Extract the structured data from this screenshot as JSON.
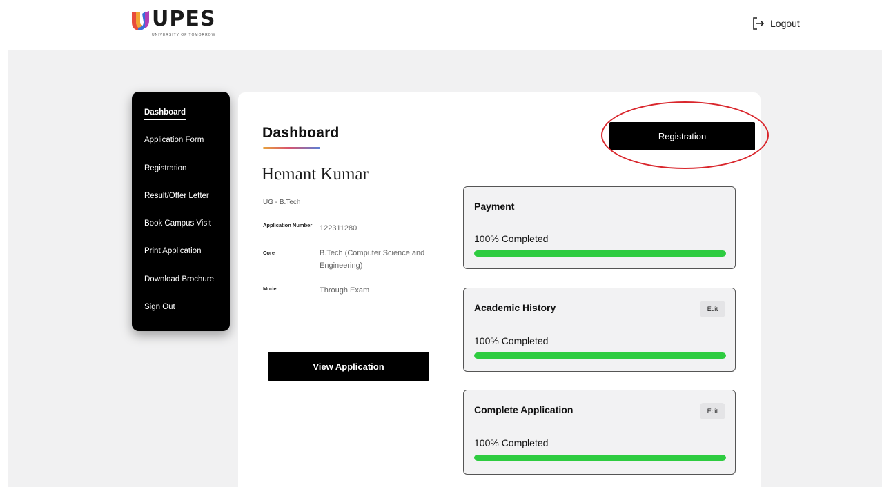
{
  "header": {
    "logo_text": "UPES",
    "logo_tagline": "UNIVERSITY OF TOMORROW",
    "logout_label": "Logout"
  },
  "sidebar": {
    "items": [
      {
        "label": "Dashboard",
        "active": true
      },
      {
        "label": "Application Form"
      },
      {
        "label": "Registration"
      },
      {
        "label": "Result/Offer Letter"
      },
      {
        "label": "Book Campus Visit"
      },
      {
        "label": "Print Application"
      },
      {
        "label": "Download Brochure"
      },
      {
        "label": "Sign Out"
      }
    ]
  },
  "main": {
    "title": "Dashboard",
    "registration_button": "Registration",
    "student": {
      "name": "Hemant Kumar",
      "program": "UG - B.Tech",
      "application_number_label": "Application Number",
      "application_number": "122311280",
      "core_label": "Core",
      "core": "B.Tech (Computer Science and Engineering)",
      "mode_label": "Mode",
      "mode": "Through Exam"
    },
    "view_application_button": "View Application",
    "status_cards": [
      {
        "title": "Payment",
        "status": "100% Completed",
        "progress": 1.0,
        "has_edit": false
      },
      {
        "title": "Academic History",
        "status": "100% Completed",
        "progress": 1.0,
        "has_edit": true,
        "edit_label": "Edit"
      },
      {
        "title": "Complete Application",
        "status": "100% Completed",
        "progress": 1.0,
        "has_edit": true,
        "edit_label": "Edit"
      }
    ]
  },
  "colors": {
    "accent_black": "#000000",
    "progress_green": "#2ecc40",
    "highlight_red": "#d9262c",
    "background_gray": "#f1f1f2"
  }
}
